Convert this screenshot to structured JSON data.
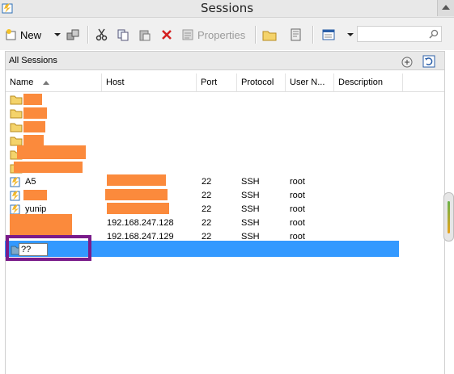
{
  "window": {
    "title": "Sessions"
  },
  "toolbar": {
    "new_label": "New",
    "properties_label": "Properties",
    "search_placeholder": ""
  },
  "path": {
    "label": "All Sessions"
  },
  "columns": [
    "Name",
    "Host",
    "Port",
    "Protocol",
    "User N...",
    "Description"
  ],
  "sessions": [
    {
      "name": "A5",
      "host": "",
      "port": "22",
      "protocol": "SSH",
      "user": "root"
    },
    {
      "name": "",
      "host": "",
      "port": "22",
      "protocol": "SSH",
      "user": "root"
    },
    {
      "name": "yunip",
      "host": "",
      "port": "22",
      "protocol": "SSH",
      "user": "root"
    },
    {
      "name": "",
      "host": "192.168.247.128",
      "port": "22",
      "protocol": "SSH",
      "user": "root"
    },
    {
      "name": "",
      "host": "192.168.247.129",
      "port": "22",
      "protocol": "SSH",
      "user": "root"
    }
  ],
  "rename": {
    "value": "??"
  },
  "colors": {
    "selection": "#3399ff",
    "redaction": "#fb8a3c",
    "highlight": "#7a1b8a"
  }
}
